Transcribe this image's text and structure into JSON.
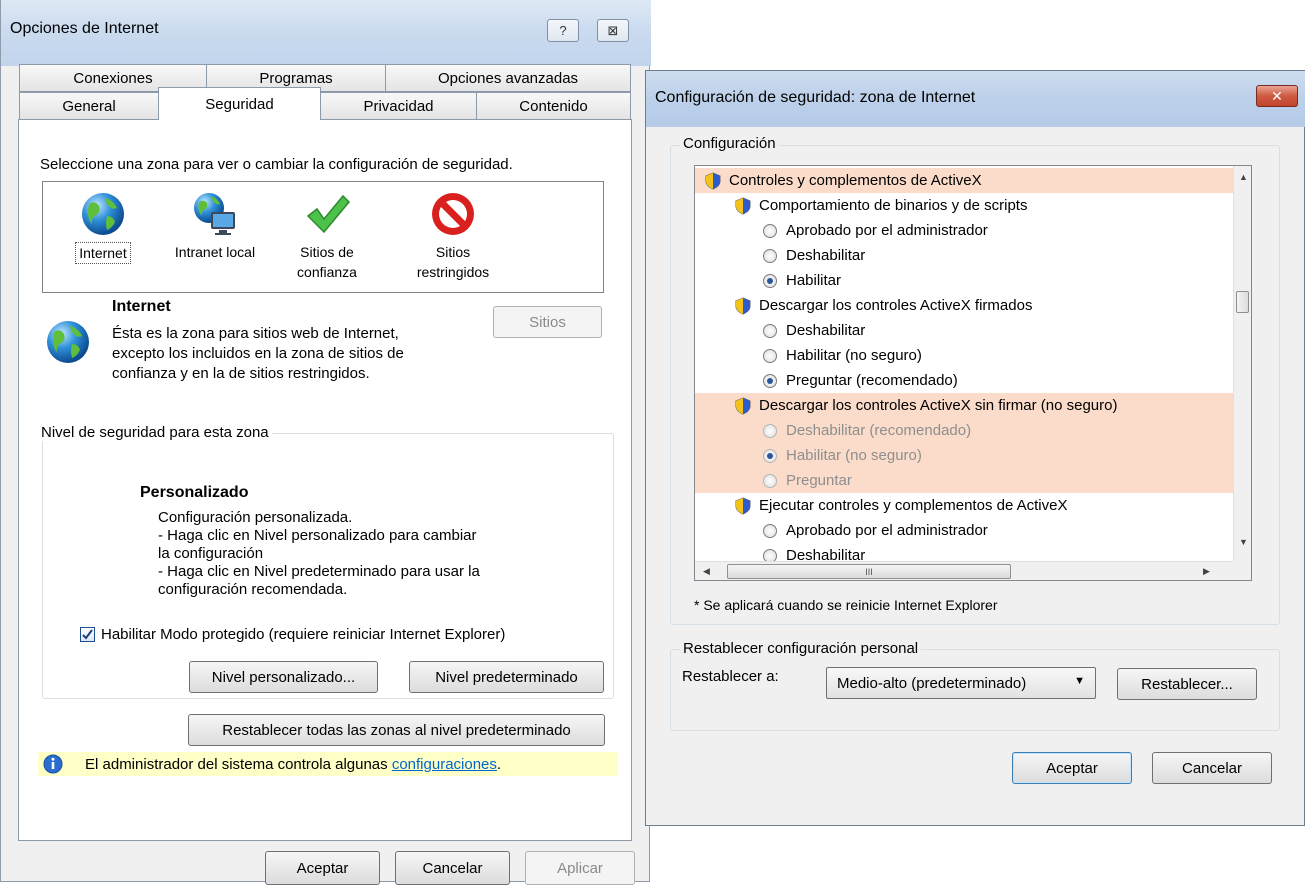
{
  "colors": {
    "highlight": "#fbdcca",
    "info_bar": "#ffffc8",
    "link": "#0066cc",
    "title_blue": "#c1d4ec"
  },
  "left_dialog": {
    "title": "Opciones de Internet",
    "help_glyph": "?",
    "close_glyph": "⊠",
    "tabs_row1": [
      "Conexiones",
      "Programas",
      "Opciones avanzadas"
    ],
    "tabs_row2": [
      "General",
      "Seguridad",
      "Privacidad",
      "Contenido"
    ],
    "active_tab": "Seguridad",
    "zone_prompt": "Seleccione una zona para ver o cambiar la configuración de seguridad.",
    "zones": [
      {
        "label": "Internet",
        "icon": "globe-icon"
      },
      {
        "label": "Intranet local",
        "icon": "intranet-icon"
      },
      {
        "label": "Sitios de\nconfianza",
        "icon": "checkmark-icon"
      },
      {
        "label": "Sitios\nrestringidos",
        "icon": "prohibited-icon"
      }
    ],
    "selected_zone": {
      "name": "Internet",
      "description": "Ésta es la zona para sitios web de Internet,\nexcepto los incluidos en la zona de sitios de\nconfianza y en la de sitios restringidos.",
      "sites_button": "Sitios"
    },
    "security_level": {
      "group_label": "Nivel de seguridad para esta zona",
      "level_name": "Personalizado",
      "level_text": "Configuración personalizada.\n- Haga clic en Nivel personalizado para cambiar\n  la configuración\n- Haga clic en Nivel predeterminado para usar la\n  configuración recomendada.",
      "protected_mode_label": "Habilitar Modo protegido (requiere reiniciar Internet Explorer)",
      "protected_mode_checked": true,
      "custom_level_button": "Nivel personalizado...",
      "default_level_button": "Nivel predeterminado"
    },
    "reset_all_button": "Restablecer todas las zonas al nivel predeterminado",
    "admin_notice": {
      "text": "El administrador del sistema controla algunas ",
      "link": "configuraciones",
      "suffix": "."
    },
    "buttons": {
      "ok": "Aceptar",
      "cancel": "Cancelar",
      "apply": "Aplicar"
    }
  },
  "right_dialog": {
    "title": "Configuración de seguridad: zona de Internet",
    "close_glyph": "✕",
    "settings_group_label": "Configuración",
    "settings": [
      {
        "type": "category",
        "label": "Controles y complementos de ActiveX",
        "highlight": true,
        "indent": 0
      },
      {
        "type": "setting",
        "label": "Comportamiento de binarios y de scripts",
        "indent": 1
      },
      {
        "type": "option",
        "label": "Aprobado por el administrador",
        "checked": false,
        "indent": 2
      },
      {
        "type": "option",
        "label": "Deshabilitar",
        "checked": false,
        "indent": 2
      },
      {
        "type": "option",
        "label": "Habilitar",
        "checked": true,
        "indent": 2
      },
      {
        "type": "setting",
        "label": "Descargar los controles ActiveX firmados",
        "indent": 1
      },
      {
        "type": "option",
        "label": "Deshabilitar",
        "checked": false,
        "indent": 2
      },
      {
        "type": "option",
        "label": "Habilitar (no seguro)",
        "checked": false,
        "indent": 2
      },
      {
        "type": "option",
        "label": "Preguntar (recomendado)",
        "checked": true,
        "indent": 2
      },
      {
        "type": "setting",
        "label": "Descargar los controles ActiveX sin firmar (no seguro)",
        "highlight": true,
        "indent": 1
      },
      {
        "type": "option",
        "label": "Deshabilitar (recomendado)",
        "checked": false,
        "highlight": true,
        "disabled": true,
        "indent": 2
      },
      {
        "type": "option",
        "label": "Habilitar (no seguro)",
        "checked": true,
        "highlight": true,
        "disabled": true,
        "indent": 2
      },
      {
        "type": "option",
        "label": "Preguntar",
        "checked": false,
        "highlight": true,
        "disabled": true,
        "indent": 2
      },
      {
        "type": "setting",
        "label": "Ejecutar controles y complementos de ActiveX",
        "indent": 1
      },
      {
        "type": "option",
        "label": "Aprobado por el administrador",
        "checked": false,
        "indent": 2
      },
      {
        "type": "option",
        "label": "Deshabilitar",
        "checked": false,
        "indent": 2
      }
    ],
    "hscroll_thumb_glyph": "III",
    "restart_note": "* Se aplicará cuando se reinicie Internet Explorer",
    "reset_group_label": "Restablecer configuración personal",
    "reset_to_label": "Restablecer a:",
    "reset_dropdown_value": "Medio-alto (predeterminado)",
    "reset_button": "Restablecer...",
    "buttons": {
      "ok": "Aceptar",
      "cancel": "Cancelar"
    }
  }
}
